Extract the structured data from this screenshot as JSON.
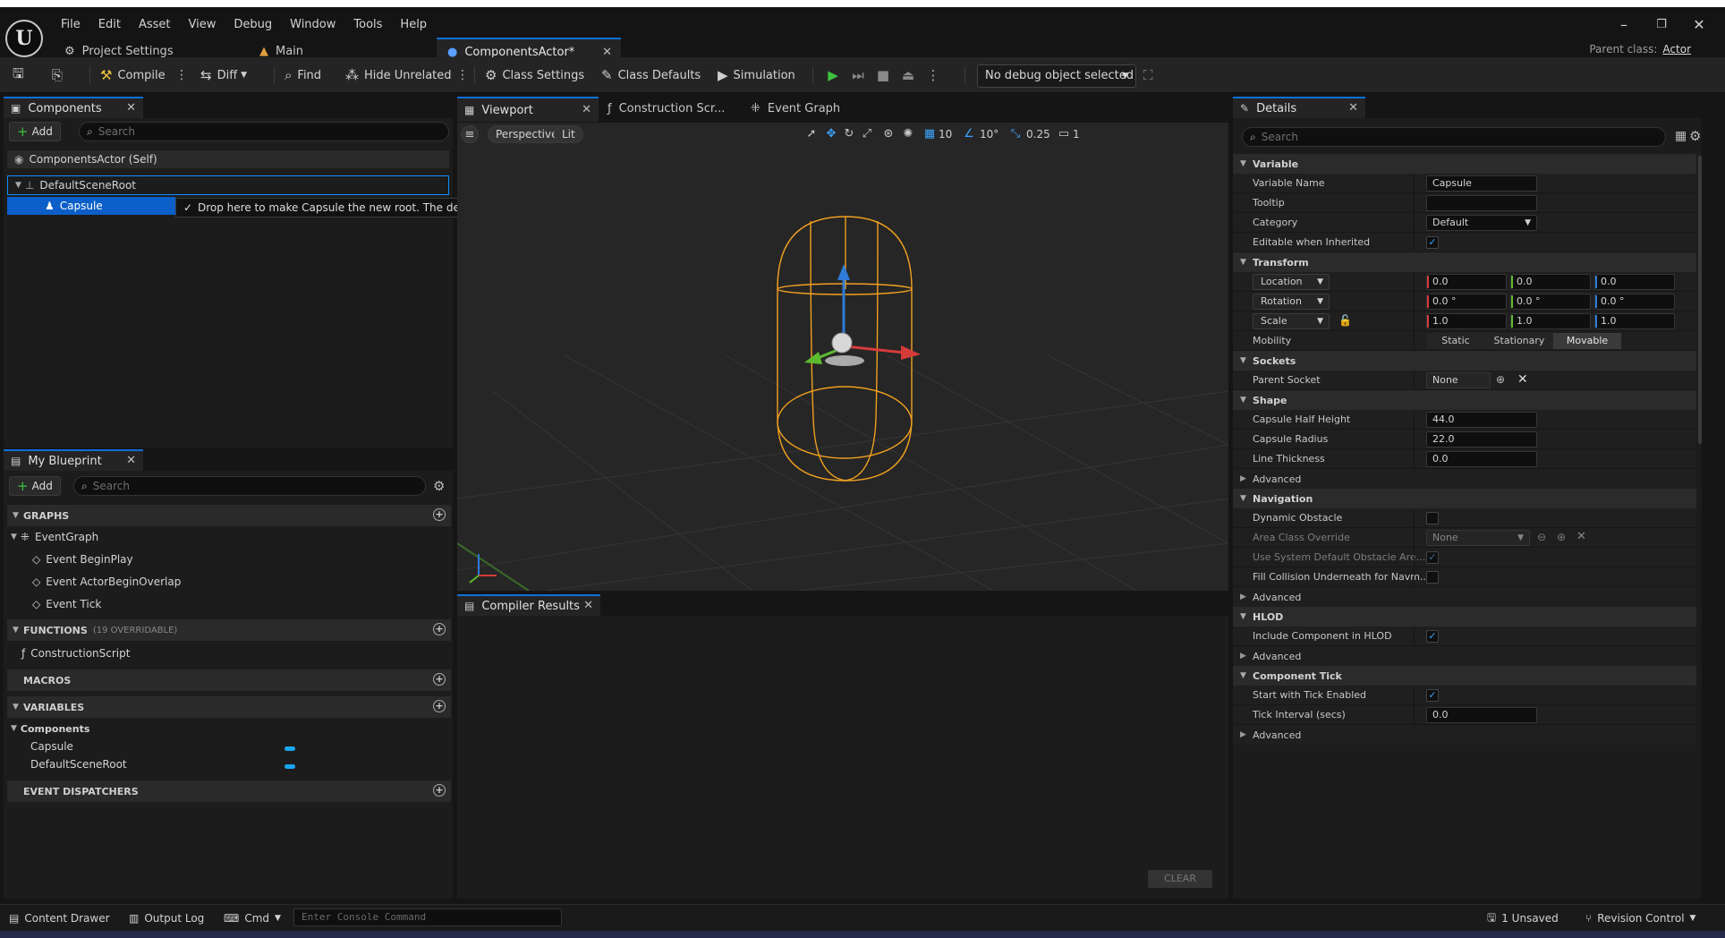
{
  "menu": [
    "File",
    "Edit",
    "Asset",
    "View",
    "Debug",
    "Window",
    "Tools",
    "Help"
  ],
  "tabs": [
    {
      "label": "Project Settings"
    },
    {
      "label": "Main"
    },
    {
      "label": "ComponentsActor*"
    }
  ],
  "parent_class": {
    "label": "Parent class:",
    "value": "Actor"
  },
  "toolbar": {
    "compile": "Compile",
    "diff": "Diff",
    "find": "Find",
    "hide_unrelated": "Hide Unrelated",
    "class_settings": "Class Settings",
    "class_defaults": "Class Defaults",
    "simulation": "Simulation",
    "debug_object": "No debug object selected"
  },
  "components": {
    "title": "Components",
    "add": "Add",
    "search_placeholder": "Search",
    "self": "ComponentsActor (Self)",
    "root": "DefaultSceneRoot",
    "child": "Capsule",
    "tooltip": "Drop here to make Capsule the new root. The default root will be deleted."
  },
  "my_blueprint": {
    "title": "My Blueprint",
    "add": "Add",
    "search_placeholder": "Search",
    "graphs": "GRAPHS",
    "event_graph": "EventGraph",
    "events": [
      "Event BeginPlay",
      "Event ActorBeginOverlap",
      "Event Tick"
    ],
    "functions": "FUNCTIONS",
    "functions_sub": "(19 OVERRIDABLE)",
    "construction_script": "ConstructionScript",
    "macros": "MACROS",
    "variables": "VARIABLES",
    "var_category": "Components",
    "vars": [
      "Capsule",
      "DefaultSceneRoot"
    ],
    "dispatchers": "EVENT DISPATCHERS"
  },
  "editor_tabs": {
    "viewport": "Viewport",
    "construction": "Construction Scr...",
    "event_graph": "Event Graph"
  },
  "viewport": {
    "perspective": "Perspective",
    "lit": "Lit",
    "grid": "10",
    "angle": "10°",
    "scale": "0.25",
    "camera": "1"
  },
  "compiler": {
    "title": "Compiler Results",
    "clear": "CLEAR"
  },
  "details": {
    "title": "Details",
    "search_placeholder": "Search",
    "variable": "Variable",
    "variable_name_label": "Variable Name",
    "variable_name": "Capsule",
    "tooltip_label": "Tooltip",
    "category_label": "Category",
    "category": "Default",
    "editable_label": "Editable when Inherited",
    "transform": "Transform",
    "location": "Location",
    "rotation": "Rotation",
    "scale": "Scale",
    "loc": [
      "0.0",
      "0.0",
      "0.0"
    ],
    "rot": [
      "0.0 °",
      "0.0 °",
      "0.0 °"
    ],
    "scl": [
      "1.0",
      "1.0",
      "1.0"
    ],
    "mobility_label": "Mobility",
    "mobility": [
      "Static",
      "Stationary",
      "Movable"
    ],
    "sockets": "Sockets",
    "parent_socket_label": "Parent Socket",
    "parent_socket": "None",
    "shape": "Shape",
    "half_height_label": "Capsule Half Height",
    "half_height": "44.0",
    "radius_label": "Capsule Radius",
    "radius": "22.0",
    "line_label": "Line Thickness",
    "line": "0.0",
    "advanced": "Advanced",
    "navigation": "Navigation",
    "dyn_obstacle": "Dynamic Obstacle",
    "area_class_label": "Area Class Override",
    "area_class": "None",
    "use_default": "Use System Default Obstacle Are...",
    "fill_collision": "Fill Collision Underneath for Navm...",
    "hlod": "HLOD",
    "include_hlod": "Include Component in HLOD",
    "component_tick": "Component Tick",
    "start_tick": "Start with Tick Enabled",
    "tick_interval_label": "Tick Interval (secs)",
    "tick_interval": "0.0"
  },
  "statusbar": {
    "content_drawer": "Content Drawer",
    "output_log": "Output Log",
    "cmd": "Cmd",
    "console_placeholder": "Enter Console Command",
    "unsaved": "1 Unsaved",
    "revision": "Revision Control"
  },
  "colors": {
    "accent": "#0f6fd6",
    "selection": "#0c5fc8",
    "capsule": "#f0a020"
  }
}
